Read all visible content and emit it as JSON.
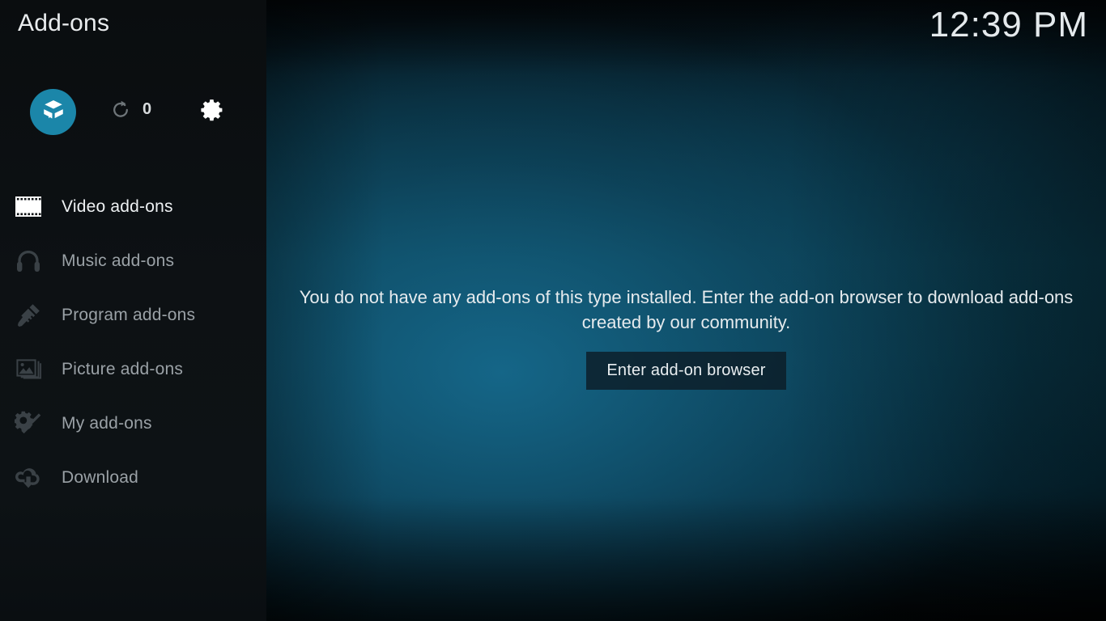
{
  "window": {
    "title": "Add-ons",
    "clock": "12:39 PM"
  },
  "colors": {
    "accent": "#1b86a9",
    "sidebar_bg": "#0d1114",
    "content_bg": "#0b4457",
    "active_text": "#eef1f3",
    "inactive_text": "#9aa1a6",
    "button_bg": "#0c1c26"
  },
  "toolbar": {
    "addon_browser": {
      "icon": "open-box-icon",
      "label": "Add-on browser"
    },
    "refresh": {
      "icon": "refresh-icon",
      "label": "Check for updates"
    },
    "update_count": "0",
    "settings": {
      "icon": "gear-icon",
      "label": "Settings"
    }
  },
  "sidebar": {
    "items": [
      {
        "label": "Video add-ons",
        "icon": "film-strip-icon",
        "active": true
      },
      {
        "label": "Music add-ons",
        "icon": "headphones-icon",
        "active": false
      },
      {
        "label": "Program add-ons",
        "icon": "ruler-pencil-icon",
        "active": false
      },
      {
        "label": "Picture add-ons",
        "icon": "picture-frame-icon",
        "active": false
      },
      {
        "label": "My add-ons",
        "icon": "gear-screwdriver-icon",
        "active": false
      },
      {
        "label": "Download",
        "icon": "cloud-download-icon",
        "active": false
      }
    ]
  },
  "main": {
    "empty_message": "You do not have any add-ons of this type installed. Enter the add-on browser to download add-ons created by our community.",
    "enter_browser_label": "Enter add-on browser"
  }
}
